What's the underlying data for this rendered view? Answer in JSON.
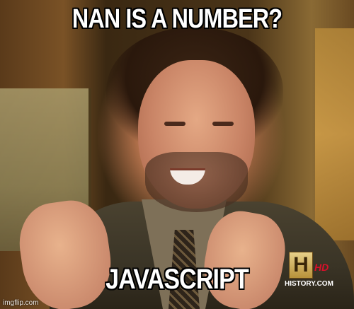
{
  "meme": {
    "top_caption": "NAN IS A NUMBER?",
    "bottom_caption": "JAVASCRIPT"
  },
  "channel_logo": {
    "letter": "H",
    "badge": "HD",
    "site": "HISTORY.COM"
  },
  "watermark": "imgflip.com"
}
